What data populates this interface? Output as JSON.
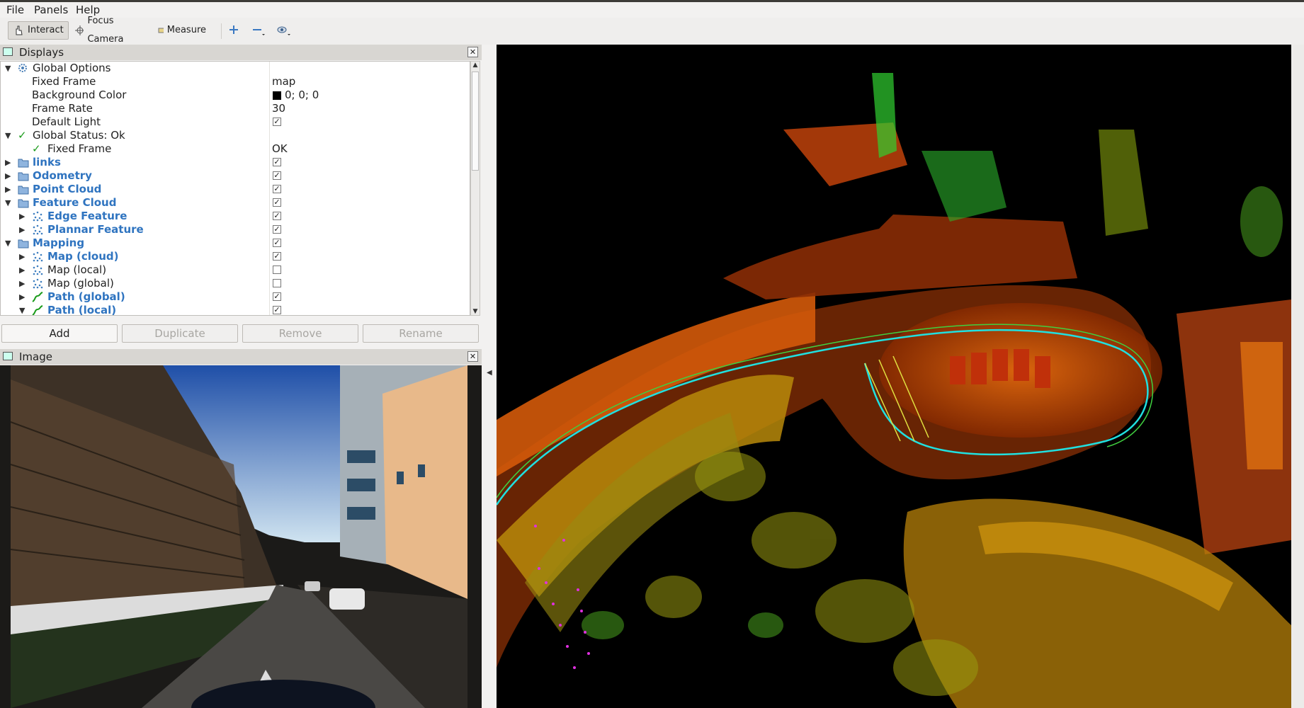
{
  "menu": {
    "file": "File",
    "panels": "Panels",
    "help": "Help"
  },
  "toolbar": {
    "interact": "Interact",
    "focus_camera": "Focus Camera",
    "measure": "Measure"
  },
  "displays": {
    "title": "Displays",
    "rows": {
      "global_options": "Global Options",
      "fixed_frame": "Fixed Frame",
      "fixed_frame_val": "map",
      "background_color": "Background Color",
      "background_color_val": "0; 0; 0",
      "frame_rate": "Frame Rate",
      "frame_rate_val": "30",
      "default_light": "Default Light",
      "global_status": "Global Status: Ok",
      "status_fixed_frame": "Fixed Frame",
      "status_fixed_frame_val": "OK",
      "links": "links",
      "odometry": "Odometry",
      "point_cloud": "Point Cloud",
      "feature_cloud": "Feature Cloud",
      "edge_feature": "Edge Feature",
      "plannar_feature": "Plannar Feature",
      "mapping": "Mapping",
      "map_cloud": "Map (cloud)",
      "map_local": "Map (local)",
      "map_global": "Map (global)",
      "path_global": "Path (global)",
      "path_local": "Path (local)"
    },
    "buttons": {
      "add": "Add",
      "duplicate": "Duplicate",
      "remove": "Remove",
      "rename": "Rename"
    }
  },
  "image_panel": {
    "title": "Image"
  },
  "colors": {
    "link_blue": "#2f74c0",
    "check_green": "#1a9b1a",
    "viewport_bg": "#000000"
  }
}
